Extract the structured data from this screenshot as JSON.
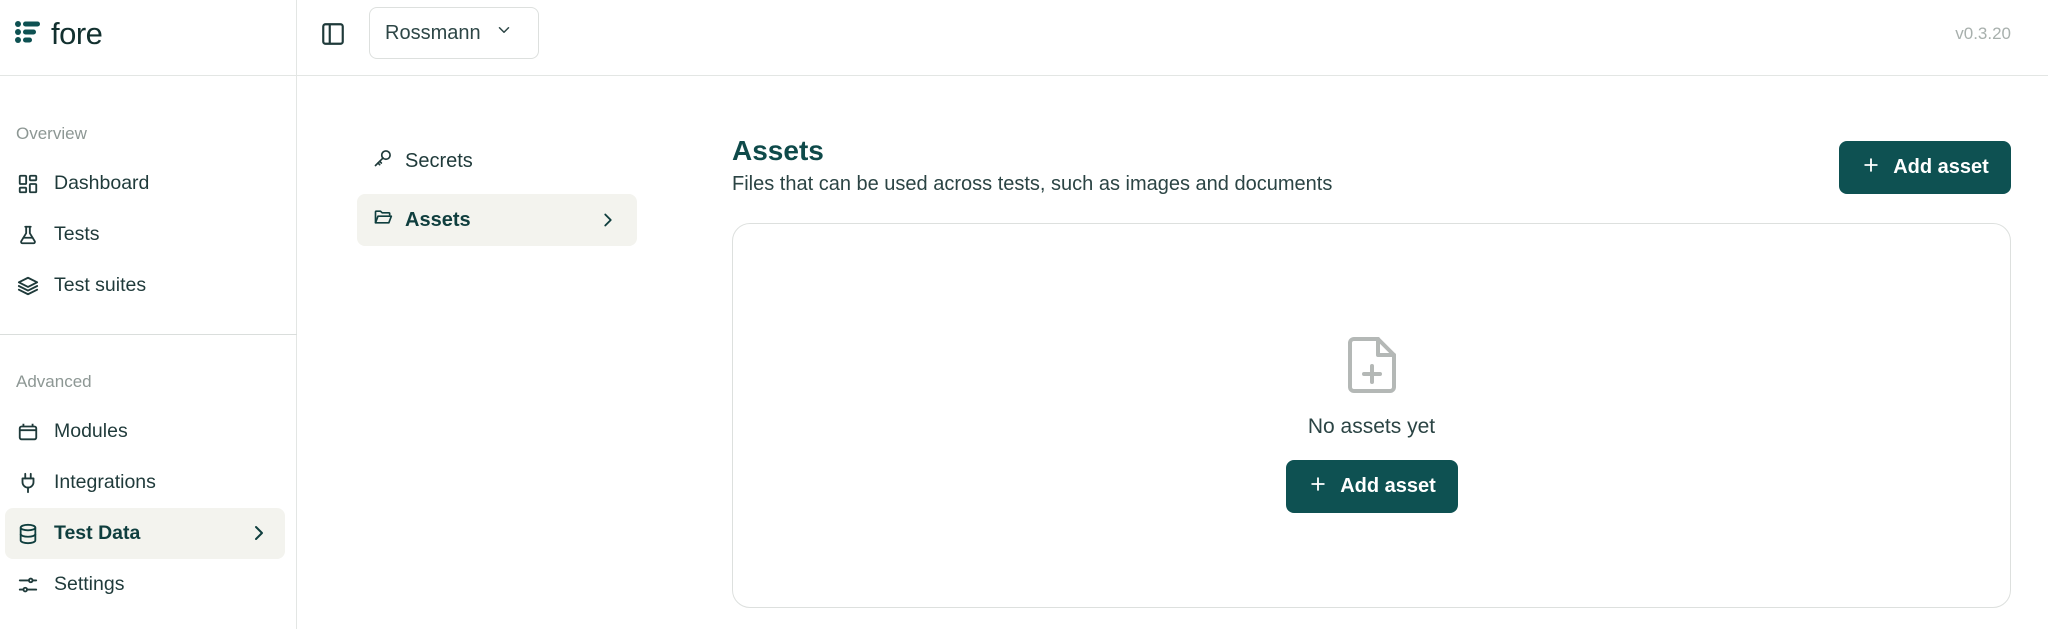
{
  "app": {
    "name": "fore",
    "version": "v0.3.20"
  },
  "colors": {
    "accent": "#0e5152",
    "active_bg": "#f3f3ee",
    "border": "#dde0de"
  },
  "header": {
    "project": "Rossmann",
    "icons": {
      "panel_toggle": "sidebar-panel-icon",
      "project_chevron": "chevron-down-icon"
    }
  },
  "sidebar": {
    "sections": [
      {
        "label": "Overview",
        "items": [
          {
            "label": "Dashboard",
            "icon": "grid-icon"
          },
          {
            "label": "Tests",
            "icon": "flask-icon"
          },
          {
            "label": "Test suites",
            "icon": "layers-icon"
          }
        ]
      },
      {
        "label": "Advanced",
        "items": [
          {
            "label": "Modules",
            "icon": "box-icon"
          },
          {
            "label": "Integrations",
            "icon": "plug-icon"
          },
          {
            "label": "Test Data",
            "icon": "database-icon",
            "active": true
          },
          {
            "label": "Settings",
            "icon": "sliders-icon"
          }
        ]
      }
    ]
  },
  "subnav": {
    "items": [
      {
        "label": "Secrets",
        "icon": "key-icon"
      },
      {
        "label": "Assets",
        "icon": "folder-open-icon",
        "active": true
      }
    ]
  },
  "main": {
    "title": "Assets",
    "description": "Files that can be used across tests, such as images and documents",
    "add_button": "Add asset",
    "empty_state": {
      "icon": "file-plus-icon",
      "text": "No assets yet",
      "button": "Add asset"
    }
  }
}
